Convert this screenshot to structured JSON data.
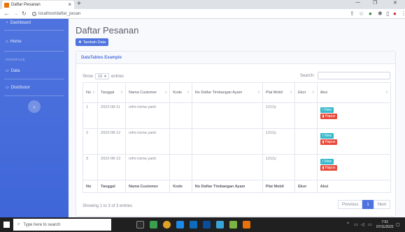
{
  "browser": {
    "tab_title": "Daftar Pesanan",
    "tab_close": "×",
    "new_tab": "+",
    "url": "localhost/daftar_pesan",
    "win_minimize": "—",
    "win_restore": "❐",
    "win_close": "✕"
  },
  "sidebar": {
    "dashboard": "Dashboard",
    "home": "Home",
    "heading_interface": "INTERFACE",
    "data": "Data",
    "distributor": "Distributor",
    "toggle": "‹"
  },
  "page": {
    "title": "Daftar Pesanan",
    "add_button": "Tambah Data"
  },
  "card": {
    "header": "DataTables Example",
    "show_label": "Show",
    "entries_value": "10",
    "entries_label": "entries",
    "search_label": "Search:",
    "columns": [
      "No",
      "Tanggal",
      "Nama Customer",
      "Kode",
      "No Daftar Timbangan Ayam",
      "Plat Mobil",
      "Ekor",
      "Aksi"
    ],
    "rows": [
      {
        "no": "1",
        "tanggal": "2022-08-11",
        "customer": "refni rizma yanti",
        "kode": "",
        "timbangan": "",
        "plat": "1212y",
        "ekor": ""
      },
      {
        "no": "2",
        "tanggal": "2022-08-12",
        "customer": "refni rizma yanti",
        "kode": "",
        "timbangan": "",
        "plat": "1212y",
        "ekor": ""
      },
      {
        "no": "3",
        "tanggal": "2022-08-13",
        "customer": "refni rizma yanti",
        "kode": "",
        "timbangan": "",
        "plat": "1212y",
        "ekor": ""
      }
    ],
    "view_label": "View",
    "hapus_label": "Hapus",
    "showing_text": "Showing 1 to 3 of 3 entries",
    "pager": {
      "previous": "Previous",
      "page": "1",
      "next": "Next"
    }
  },
  "taskbar": {
    "search_placeholder": "Type here to search",
    "time": "7:51",
    "date": "07/11/2022"
  },
  "colors": {
    "primary": "#4e73df",
    "info": "#36b9cc",
    "danger": "#e74a3b"
  }
}
